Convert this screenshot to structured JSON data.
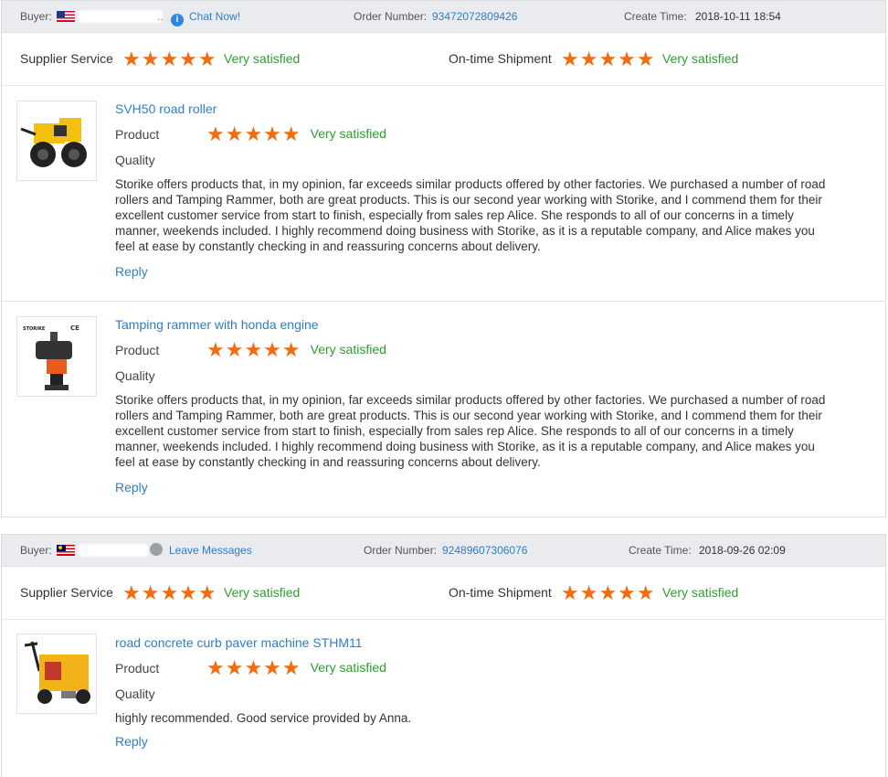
{
  "orders": [
    {
      "buyer_label": "Buyer:",
      "buyer_flag": "us-flag-icon",
      "buyer_trailing": "..",
      "contact_label": "Chat Now!",
      "contact_icon": "info-chat-icon",
      "order_number_label": "Order Number:",
      "order_number": "93472072809426",
      "create_time_label": "Create Time:",
      "create_time": "2018-10-11 18:54",
      "supplier_service_label": "Supplier Service",
      "supplier_service_rating": 5,
      "supplier_service_text": "Very satisfied",
      "ontime_label": "On-time Shipment",
      "ontime_rating": 5,
      "ontime_text": "Very satisfied",
      "products": [
        {
          "title": "SVH50 road roller",
          "image": "road-roller-image",
          "product_label": "Product",
          "quality_label": "Quality",
          "rating": 5,
          "rating_text": "Very satisfied",
          "review": "Storike offers products that, in my opinion, far exceeds similar products offered by other factories. We purchased a number of road rollers and Tamping Rammer, both are great products. This is our second year working with Storike, and I commend them for their excellent customer service from start to finish, especially from sales rep Alice. She responds to all of our concerns in a timely manner, weekends included. I highly recommend doing business with Storike, as it is a reputable company, and Alice makes you feel at ease by constantly checking in and reassuring concerns about delivery.",
          "reply_label": "Reply"
        },
        {
          "title": "Tamping rammer with honda engine",
          "image": "tamping-rammer-image",
          "image_brand": "STORIKE",
          "image_mark": "CE",
          "product_label": "Product",
          "quality_label": "Quality",
          "rating": 5,
          "rating_text": "Very satisfied",
          "review": "Storike offers products that, in my opinion, far exceeds similar products offered by other factories. We purchased a number of road rollers and Tamping Rammer, both are great products. This is our second year working with Storike, and I commend them for their excellent customer service from start to finish, especially from sales rep Alice. She responds to all of our concerns in a timely manner, weekends included. I highly recommend doing business with Storike, as it is a reputable company, and Alice makes you feel at ease by constantly checking in and reassuring concerns about delivery.",
          "reply_label": "Reply"
        }
      ]
    },
    {
      "buyer_label": "Buyer:",
      "buyer_flag": "malaysia-flag-icon",
      "contact_label": "Leave Messages",
      "contact_icon": "message-icon",
      "order_number_label": "Order Number:",
      "order_number": "92489607306076",
      "create_time_label": "Create Time:",
      "create_time": "2018-09-26 02:09",
      "supplier_service_label": "Supplier Service",
      "supplier_service_rating": 5,
      "supplier_service_text": "Very satisfied",
      "ontime_label": "On-time Shipment",
      "ontime_rating": 5,
      "ontime_text": "Very satisfied",
      "products": [
        {
          "title": "road concrete curb paver machine STHM11",
          "image": "curb-paver-machine-image",
          "product_label": "Product",
          "quality_label": "Quality",
          "rating": 5,
          "rating_text": "Very satisfied",
          "review": "highly recommended. Good service provided by Anna.",
          "reply_label": "Reply"
        }
      ]
    }
  ],
  "colors": {
    "header_bg": "#e9ebef",
    "link_blue": "#2d7ec9",
    "star_orange": "#f26b0f",
    "satisfied_green": "#2f9d2f"
  },
  "star_glyph": "★★★★★"
}
